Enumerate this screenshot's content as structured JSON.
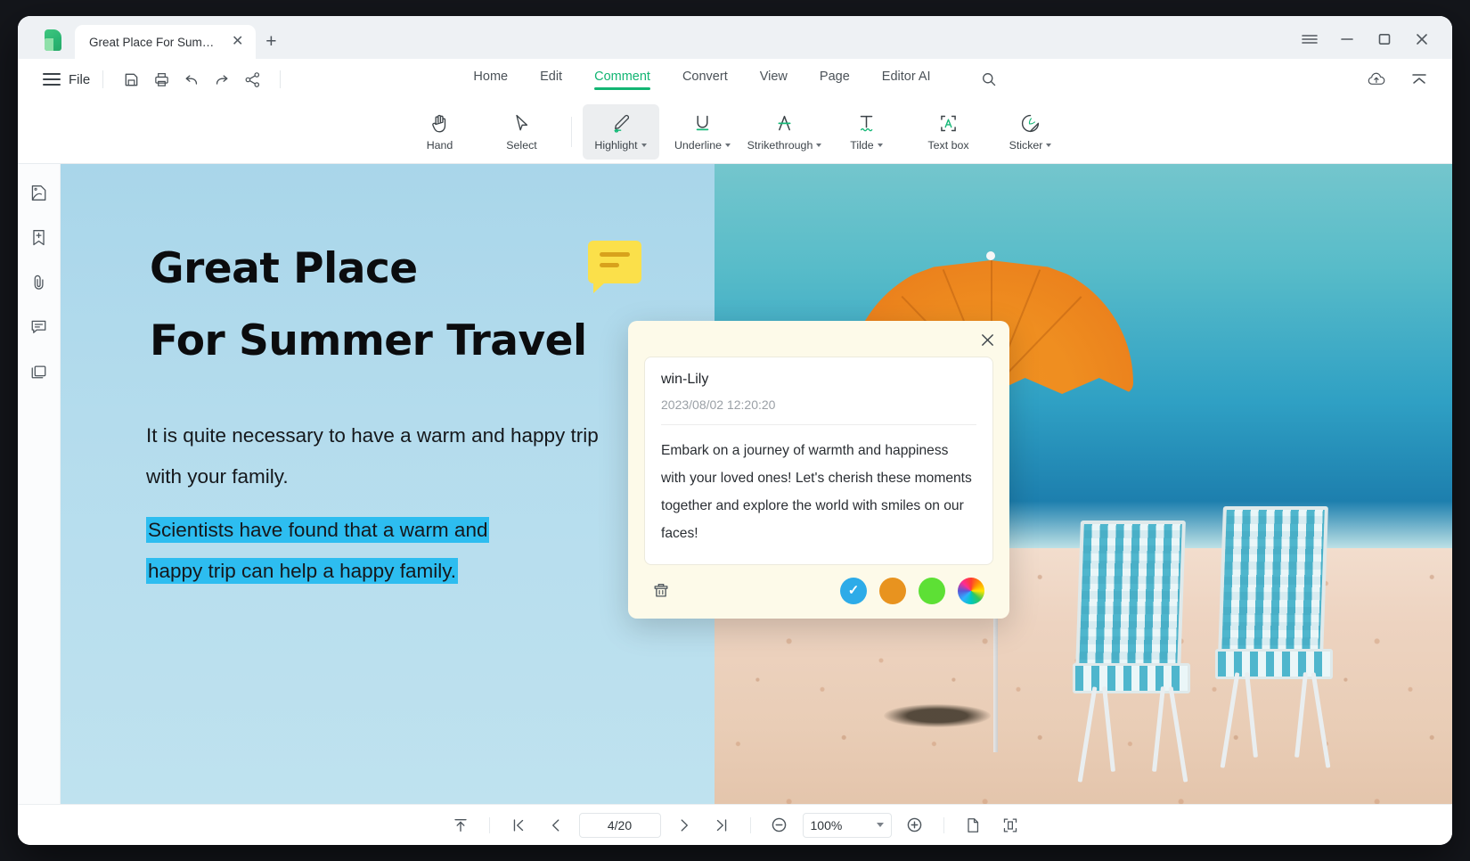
{
  "app": {
    "logo_icon": "pdf-app-logo"
  },
  "tabbar": {
    "tab_title": "Great Place For Summer T...",
    "tab_close_icon": "close-icon",
    "new_tab_icon": "plus-icon",
    "window_menu_icon": "hamburger-menu-icon",
    "minimize_icon": "minimize-icon",
    "maximize_icon": "maximize-icon",
    "close_icon": "close-icon"
  },
  "menu": {
    "file_label": "File",
    "menu_icon": "hamburger-icon",
    "quick_actions": [
      {
        "name": "save-icon",
        "label": "Save"
      },
      {
        "name": "print-icon",
        "label": "Print"
      },
      {
        "name": "undo-icon",
        "label": "Undo"
      },
      {
        "name": "redo-icon",
        "label": "Redo"
      },
      {
        "name": "share-icon",
        "label": "Share"
      }
    ],
    "tabs": [
      {
        "label": "Home",
        "active": false
      },
      {
        "label": "Edit",
        "active": false
      },
      {
        "label": "Comment",
        "active": true
      },
      {
        "label": "Convert",
        "active": false
      },
      {
        "label": "View",
        "active": false
      },
      {
        "label": "Page",
        "active": false
      },
      {
        "label": "Editor AI",
        "active": false
      }
    ],
    "search_icon": "search-icon",
    "cloud_upload_icon": "cloud-upload-icon",
    "collapse_ribbon_icon": "collapse-chevron-icon"
  },
  "ribbon": {
    "tools": [
      {
        "label": "Hand",
        "icon": "hand-icon",
        "dropdown": false,
        "selected": false
      },
      {
        "label": "Select",
        "icon": "cursor-arrow-icon",
        "dropdown": false,
        "selected": false
      },
      {
        "label": "Highlight",
        "icon": "highlighter-pen-icon",
        "dropdown": true,
        "selected": true
      },
      {
        "label": "Underline",
        "icon": "underline-icon",
        "dropdown": true,
        "selected": false
      },
      {
        "label": "Strikethrough",
        "icon": "strikethrough-icon",
        "dropdown": true,
        "selected": false
      },
      {
        "label": "Tilde",
        "icon": "tilde-icon",
        "dropdown": true,
        "selected": false
      },
      {
        "label": "Text box",
        "icon": "text-box-icon",
        "dropdown": false,
        "selected": false
      },
      {
        "label": "Sticker",
        "icon": "sticker-icon",
        "dropdown": true,
        "selected": false
      }
    ]
  },
  "leftrail": {
    "items": [
      {
        "name": "thumbnail-panel-icon",
        "label": "Thumbnails"
      },
      {
        "name": "bookmark-add-icon",
        "label": "Bookmarks"
      },
      {
        "name": "attachment-paperclip-icon",
        "label": "Attachments"
      },
      {
        "name": "comment-list-icon",
        "label": "Comments"
      },
      {
        "name": "layers-icon",
        "label": "Layers"
      }
    ]
  },
  "document": {
    "title_line1": "Great Place",
    "title_line2": "For Summer Travel",
    "paragraph1": "It is quite necessary to have a warm and happy trip with your family.",
    "paragraph2_highlight_a": "Scientists have found that a warm and",
    "paragraph2_highlight_b": "happy trip can help a happy family.",
    "highlight_color": "#2dbdf0",
    "sticky_note_icon": "sticky-note-icon",
    "sticky_note_color": "#fbe04a"
  },
  "comment_popup": {
    "close_icon": "close-icon",
    "author": "win-Lily",
    "timestamp": "2023/08/02 12:20:20",
    "text": "Embark on a journey of warmth and happiness with your loved ones! Let's cherish these moments together and explore the world with smiles on our faces!",
    "delete_icon": "trash-icon",
    "colors": [
      {
        "name": "color-blue",
        "hex": "#2dabe8",
        "selected": true
      },
      {
        "name": "color-orange",
        "hex": "#e8931f",
        "selected": false
      },
      {
        "name": "color-green",
        "hex": "#5de035",
        "selected": false
      },
      {
        "name": "color-picker-rainbow",
        "hex": "rainbow",
        "selected": false
      }
    ],
    "selected_check_icon": "check-icon"
  },
  "statusbar": {
    "scroll_top_icon": "scroll-to-top-icon",
    "first_page_icon": "first-page-icon",
    "prev_page_icon": "previous-page-icon",
    "page_value": "4/20",
    "next_page_icon": "next-page-icon",
    "last_page_icon": "last-page-icon",
    "zoom_out_icon": "zoom-out-icon",
    "zoom_value": "100%",
    "zoom_in_icon": "zoom-in-icon",
    "single-page_icon": "single-page-view-icon",
    "fit_page_icon": "fit-page-icon"
  }
}
